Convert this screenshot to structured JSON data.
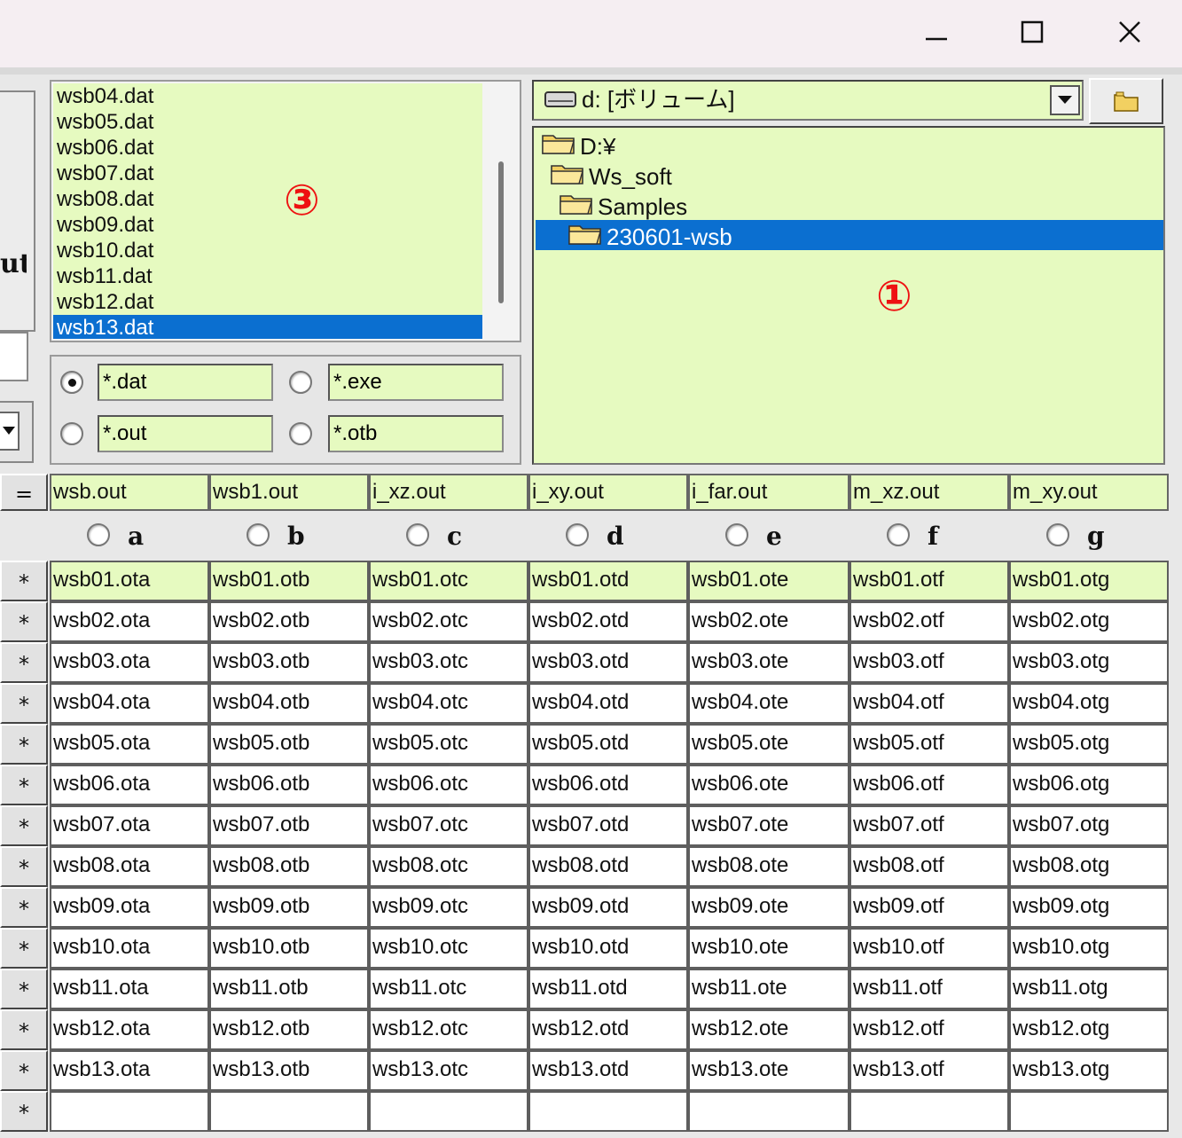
{
  "window": {
    "min_label": "—",
    "max_label": "☐",
    "close_label": "✕"
  },
  "left_fragment": {
    "out_label": "ut"
  },
  "file_list": {
    "items": [
      "wsb04.dat",
      "wsb05.dat",
      "wsb06.dat",
      "wsb07.dat",
      "wsb08.dat",
      "wsb09.dat",
      "wsb10.dat",
      "wsb11.dat",
      "wsb12.dat",
      "wsb13.dat"
    ],
    "selected_index": 9,
    "marker": "③"
  },
  "filters": [
    {
      "pattern": "*.dat",
      "selected": true
    },
    {
      "pattern": "*.exe",
      "selected": false
    },
    {
      "pattern": "*.out",
      "selected": false
    },
    {
      "pattern": "*.otb",
      "selected": false
    }
  ],
  "drive": {
    "label": "d: [ボリューム]",
    "icon": "drive-icon"
  },
  "dir_tree": {
    "items": [
      {
        "label": "D:¥",
        "icon": "folder-open-icon"
      },
      {
        "label": "Ws_soft",
        "icon": "folder-open-icon"
      },
      {
        "label": "Samples",
        "icon": "folder-open-icon"
      },
      {
        "label": "230601-wsb",
        "icon": "folder-open-icon"
      }
    ],
    "selected_index": 3,
    "marker": "①"
  },
  "grid": {
    "eq_label": "=",
    "headers": [
      "wsb.out",
      "wsb1.out",
      "i_xz.out",
      "i_xy.out",
      "i_far.out",
      "m_xz.out",
      "m_xy.out"
    ],
    "column_options": [
      "a",
      "b",
      "c",
      "d",
      "e",
      "f",
      "g"
    ],
    "row_marker": "*",
    "rows": [
      [
        "wsb01.ota",
        "wsb01.otb",
        "wsb01.otc",
        "wsb01.otd",
        "wsb01.ote",
        "wsb01.otf",
        "wsb01.otg"
      ],
      [
        "wsb02.ota",
        "wsb02.otb",
        "wsb02.otc",
        "wsb02.otd",
        "wsb02.ote",
        "wsb02.otf",
        "wsb02.otg"
      ],
      [
        "wsb03.ota",
        "wsb03.otb",
        "wsb03.otc",
        "wsb03.otd",
        "wsb03.ote",
        "wsb03.otf",
        "wsb03.otg"
      ],
      [
        "wsb04.ota",
        "wsb04.otb",
        "wsb04.otc",
        "wsb04.otd",
        "wsb04.ote",
        "wsb04.otf",
        "wsb04.otg"
      ],
      [
        "wsb05.ota",
        "wsb05.otb",
        "wsb05.otc",
        "wsb05.otd",
        "wsb05.ote",
        "wsb05.otf",
        "wsb05.otg"
      ],
      [
        "wsb06.ota",
        "wsb06.otb",
        "wsb06.otc",
        "wsb06.otd",
        "wsb06.ote",
        "wsb06.otf",
        "wsb06.otg"
      ],
      [
        "wsb07.ota",
        "wsb07.otb",
        "wsb07.otc",
        "wsb07.otd",
        "wsb07.ote",
        "wsb07.otf",
        "wsb07.otg"
      ],
      [
        "wsb08.ota",
        "wsb08.otb",
        "wsb08.otc",
        "wsb08.otd",
        "wsb08.ote",
        "wsb08.otf",
        "wsb08.otg"
      ],
      [
        "wsb09.ota",
        "wsb09.otb",
        "wsb09.otc",
        "wsb09.otd",
        "wsb09.ote",
        "wsb09.otf",
        "wsb09.otg"
      ],
      [
        "wsb10.ota",
        "wsb10.otb",
        "wsb10.otc",
        "wsb10.otd",
        "wsb10.ote",
        "wsb10.otf",
        "wsb10.otg"
      ],
      [
        "wsb11.ota",
        "wsb11.otb",
        "wsb11.otc",
        "wsb11.otd",
        "wsb11.ote",
        "wsb11.otf",
        "wsb11.otg"
      ],
      [
        "wsb12.ota",
        "wsb12.otb",
        "wsb12.otc",
        "wsb12.otd",
        "wsb12.ote",
        "wsb12.otf",
        "wsb12.otg"
      ],
      [
        "wsb13.ota",
        "wsb13.otb",
        "wsb13.otc",
        "wsb13.otd",
        "wsb13.ote",
        "wsb13.otf",
        "wsb13.otg"
      ],
      [
        "",
        "",
        "",
        "",
        "",
        "",
        ""
      ]
    ]
  },
  "colors": {
    "field_bg": "#e6fac0",
    "selection": "#0b6fd0",
    "marker": "#ee1111"
  }
}
